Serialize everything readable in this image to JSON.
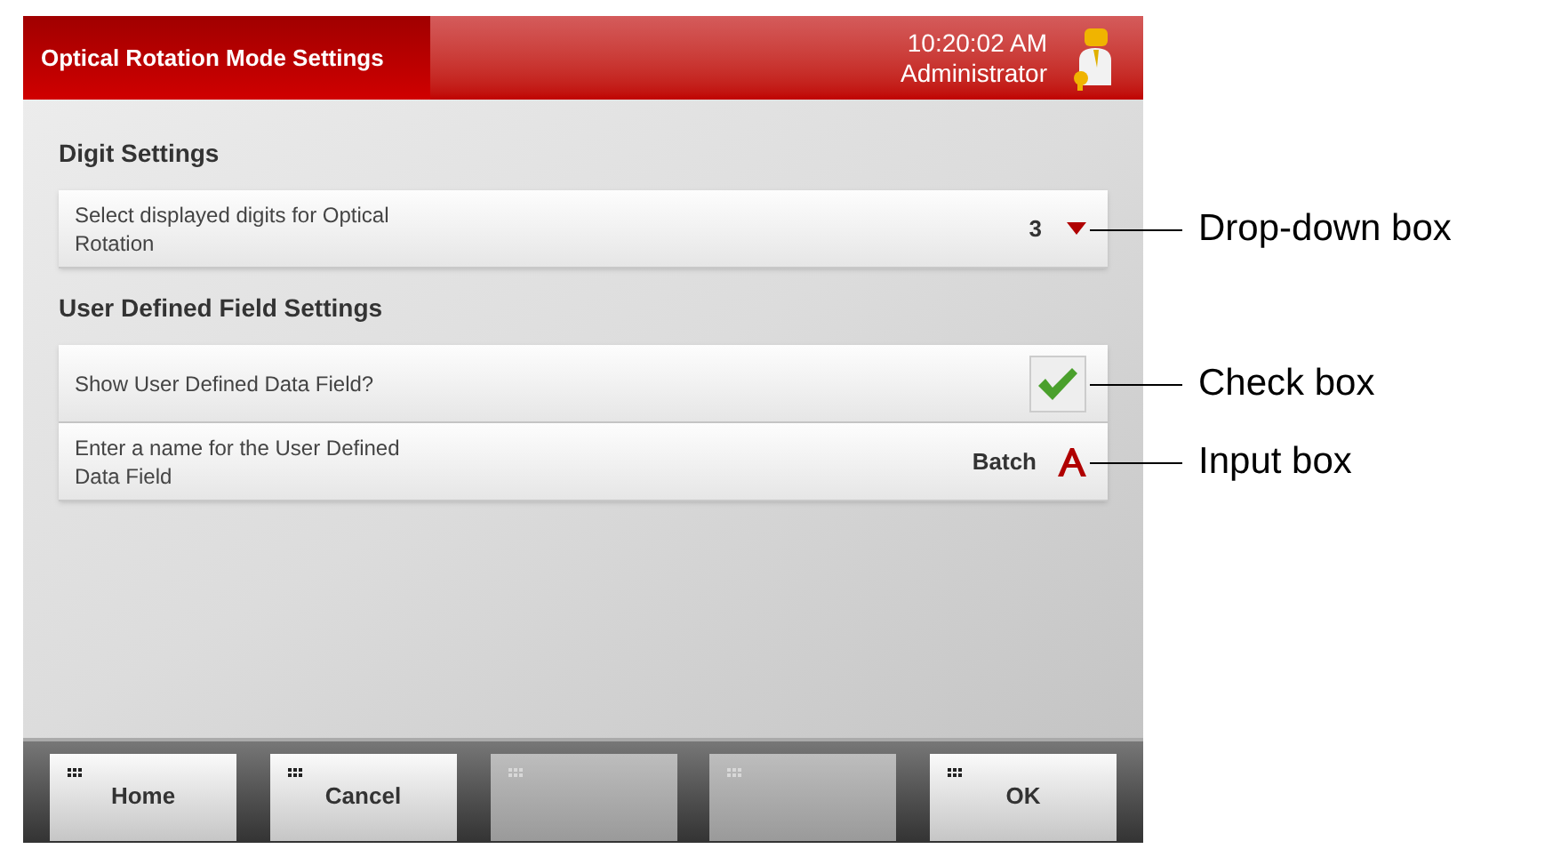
{
  "header": {
    "title": "Optical Rotation Mode Settings",
    "time": "10:20:02 AM",
    "user": "Administrator"
  },
  "sections": [
    {
      "heading": "Digit Settings",
      "rows": [
        {
          "kind": "dropdown",
          "label": "Select displayed digits for Optical Rotation",
          "value": "3",
          "callout": "Drop-down box"
        }
      ]
    },
    {
      "heading": "User Defined Field Settings",
      "rows": [
        {
          "kind": "checkbox",
          "label": "Show User Defined Data Field?",
          "checked": true,
          "callout": "Check box"
        },
        {
          "kind": "input",
          "label": "Enter a name for the User Defined Data Field",
          "value": "Batch",
          "callout": "Input box"
        }
      ]
    }
  ],
  "footer_buttons": [
    {
      "label": "Home",
      "disabled": false
    },
    {
      "label": "Cancel",
      "disabled": false
    },
    {
      "disabled": true
    },
    {
      "disabled": true
    },
    {
      "label": "OK",
      "disabled": false
    }
  ]
}
